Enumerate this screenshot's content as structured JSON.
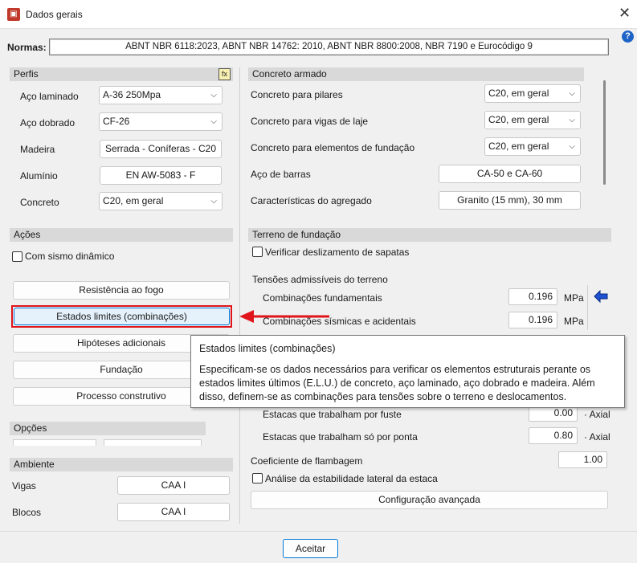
{
  "window": {
    "title": "Dados gerais",
    "close": "✕",
    "help": "?"
  },
  "normas": {
    "label": "Normas:",
    "value": "ABNT NBR 6118:2023, ABNT NBR 14762: 2010, ABNT NBR 8800:2008, NBR 7190 e Eurocódigo 9"
  },
  "perfis": {
    "title": "Perfis",
    "rows": [
      {
        "label": "Aço laminado",
        "value": "A-36 250Mpa"
      },
      {
        "label": "Aço dobrado",
        "value": "CF-26"
      },
      {
        "label": "Madeira",
        "value": "Serrada - Coníferas - C20"
      },
      {
        "label": "Alumínio",
        "value": "EN AW-5083 - F"
      },
      {
        "label": "Concreto",
        "value": "C20, em geral"
      }
    ]
  },
  "concreto_armado": {
    "title": "Concreto armado",
    "rows": [
      {
        "label": "Concreto para pilares",
        "value": "C20, em geral"
      },
      {
        "label": "Concreto para vigas de laje",
        "value": "C20, em geral"
      },
      {
        "label": "Concreto para elementos de fundação",
        "value": "C20, em geral"
      },
      {
        "label": "Aço de barras",
        "value": "CA-50 e CA-60"
      },
      {
        "label": "Características do agregado",
        "value": "Granito (15 mm), 30 mm"
      }
    ]
  },
  "acoes": {
    "title": "Ações",
    "sismo_label": "Com sismo dinâmico",
    "buttons": [
      "Resistência ao fogo",
      "Estados limites (combinações)",
      "Hipóteses adicionais",
      "Fundação",
      "Processo construtivo"
    ]
  },
  "opcoes": {
    "title": "Opções"
  },
  "ambiente": {
    "title": "Ambiente",
    "rows": [
      {
        "label": "Vigas",
        "value": "CAA I"
      },
      {
        "label": "Blocos",
        "value": "CAA I"
      }
    ]
  },
  "terreno": {
    "title": "Terreno de fundação",
    "verificar_label": "Verificar deslizamento de sapatas",
    "tensoes_title": "Tensões admissíveis do terreno",
    "comb_fund_label": "Combinações fundamentais",
    "comb_fund_value": "0.196",
    "comb_sism_label": "Combinações sísmicas e acidentais",
    "comb_sism_value": "0.196",
    "unit": "MPa",
    "estacas_fuste_label": "Estacas que trabalham por fuste",
    "estacas_fuste_value": "0.00",
    "estacas_ponta_label": "Estacas que trabalham só por ponta",
    "estacas_ponta_value": "0.80",
    "axial": "· Axial",
    "flambagem_label": "Coeficiente de flambagem",
    "flambagem_value": "1.00",
    "analise_label": "Análise da estabilidade lateral da estaca",
    "config_button": "Configuração avançada"
  },
  "tooltip": {
    "title": "Estados limites (combinações)",
    "body": "Especificam-se os dados necessários para verificar os elementos estruturais perante os estados limites últimos (E.L.U.) de concreto, aço laminado, aço dobrado e madeira. Além disso, definem-se as combinações para tensões sobre o terreno e deslocamentos."
  },
  "footer": {
    "ok": "Aceitar"
  },
  "colors": {
    "highlight": "#e0151b",
    "arrow_blue": "#1e50d2",
    "accent": "#0078d7"
  }
}
